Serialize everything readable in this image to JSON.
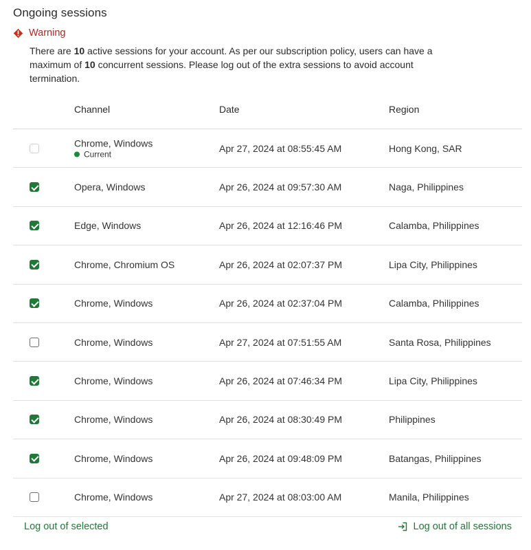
{
  "header": {
    "title": "Ongoing sessions"
  },
  "warning": {
    "title": "Warning",
    "text_1": "There are ",
    "active_count": "10",
    "text_2": " active sessions for your account. As per our subscription policy, users can have a maximum of ",
    "max_count": "10",
    "text_3": " concurrent sessions. Please log out of the extra sessions to avoid account termination.",
    "icon": "warning-diamond-icon"
  },
  "table": {
    "columns": {
      "channel": "Channel",
      "date": "Date",
      "region": "Region"
    },
    "current_label": "Current",
    "rows": [
      {
        "channel": "Chrome, Windows",
        "date": "Apr 27, 2024 at 08:55:45 AM",
        "region": "Hong Kong, SAR",
        "checked": false,
        "current": true
      },
      {
        "channel": "Opera, Windows",
        "date": "Apr 26, 2024 at 09:57:30 AM",
        "region": "Naga, Philippines",
        "checked": true,
        "current": false
      },
      {
        "channel": "Edge, Windows",
        "date": "Apr 26, 2024 at 12:16:46 PM",
        "region": "Calamba, Philippines",
        "checked": true,
        "current": false
      },
      {
        "channel": "Chrome, Chromium OS",
        "date": "Apr 26, 2024 at 02:07:37 PM",
        "region": "Lipa City, Philippines",
        "checked": true,
        "current": false
      },
      {
        "channel": "Chrome, Windows",
        "date": "Apr 26, 2024 at 02:37:04 PM",
        "region": "Calamba, Philippines",
        "checked": true,
        "current": false
      },
      {
        "channel": "Chrome, Windows",
        "date": "Apr 27, 2024 at 07:51:55 AM",
        "region": "Santa Rosa, Philippines",
        "checked": false,
        "current": false
      },
      {
        "channel": "Chrome, Windows",
        "date": "Apr 26, 2024 at 07:46:34 PM",
        "region": "Lipa City, Philippines",
        "checked": true,
        "current": false
      },
      {
        "channel": "Chrome, Windows",
        "date": "Apr 26, 2024 at 08:30:49 PM",
        "region": "Philippines",
        "checked": true,
        "current": false
      },
      {
        "channel": "Chrome, Windows",
        "date": "Apr 26, 2024 at 09:48:09 PM",
        "region": "Batangas, Philippines",
        "checked": true,
        "current": false
      },
      {
        "channel": "Chrome, Windows",
        "date": "Apr 27, 2024 at 08:03:00 AM",
        "region": "Manila, Philippines",
        "checked": false,
        "current": false
      }
    ]
  },
  "footer": {
    "logout_selected": "Log out of selected",
    "logout_all": "Log out of all sessions",
    "logout_icon": "logout-arrow-icon"
  },
  "colors": {
    "accent": "#1f7a36",
    "warning": "#b3261e",
    "current_dot": "#1f8a3a"
  }
}
